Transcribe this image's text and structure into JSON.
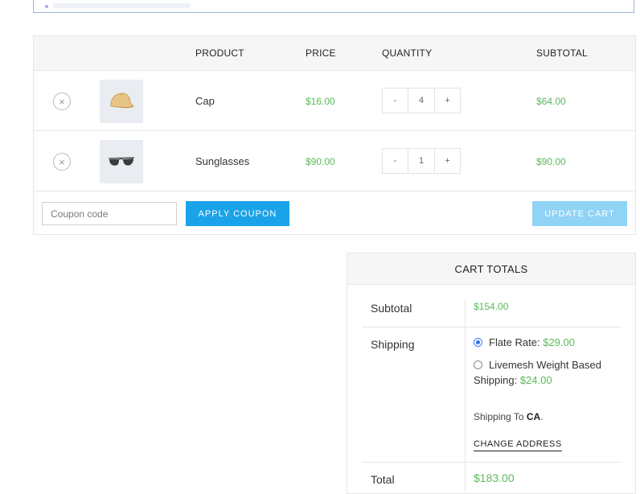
{
  "cart": {
    "headers": {
      "product": "PRODUCT",
      "price": "PRICE",
      "quantity": "QUANTITY",
      "subtotal": "SUBTOTAL"
    },
    "items": [
      {
        "name": "Cap",
        "price": "$16.00",
        "qty": "4",
        "subtotal": "$64.00",
        "remove": "×",
        "minus": "-",
        "plus": "+"
      },
      {
        "name": "Sunglasses",
        "price": "$90.00",
        "qty": "1",
        "subtotal": "$90.00",
        "remove": "×",
        "minus": "-",
        "plus": "+"
      }
    ],
    "coupon_placeholder": "Coupon code",
    "apply_label": "APPLY COUPON",
    "update_label": "UPDATE CART"
  },
  "totals": {
    "title": "CART TOTALS",
    "subtotal_label": "Subtotal",
    "subtotal_value": "$154.00",
    "shipping_label": "Shipping",
    "flat_rate_label": "Flate Rate:",
    "flat_rate_value": "$29.00",
    "weight_label": "Livemesh Weight Based Shipping:",
    "weight_value": "$24.00",
    "shipping_to_prefix": "Shipping To",
    "shipping_to_country": "CA",
    "shipping_to_suffix": ".",
    "change_address": "CHANGE ADDRESS",
    "total_label": "Total",
    "total_value": "$183.00"
  },
  "colors": {
    "accent": "#1aa3e8",
    "accent_light": "#8fd3f5",
    "price": "#5cb85c"
  }
}
